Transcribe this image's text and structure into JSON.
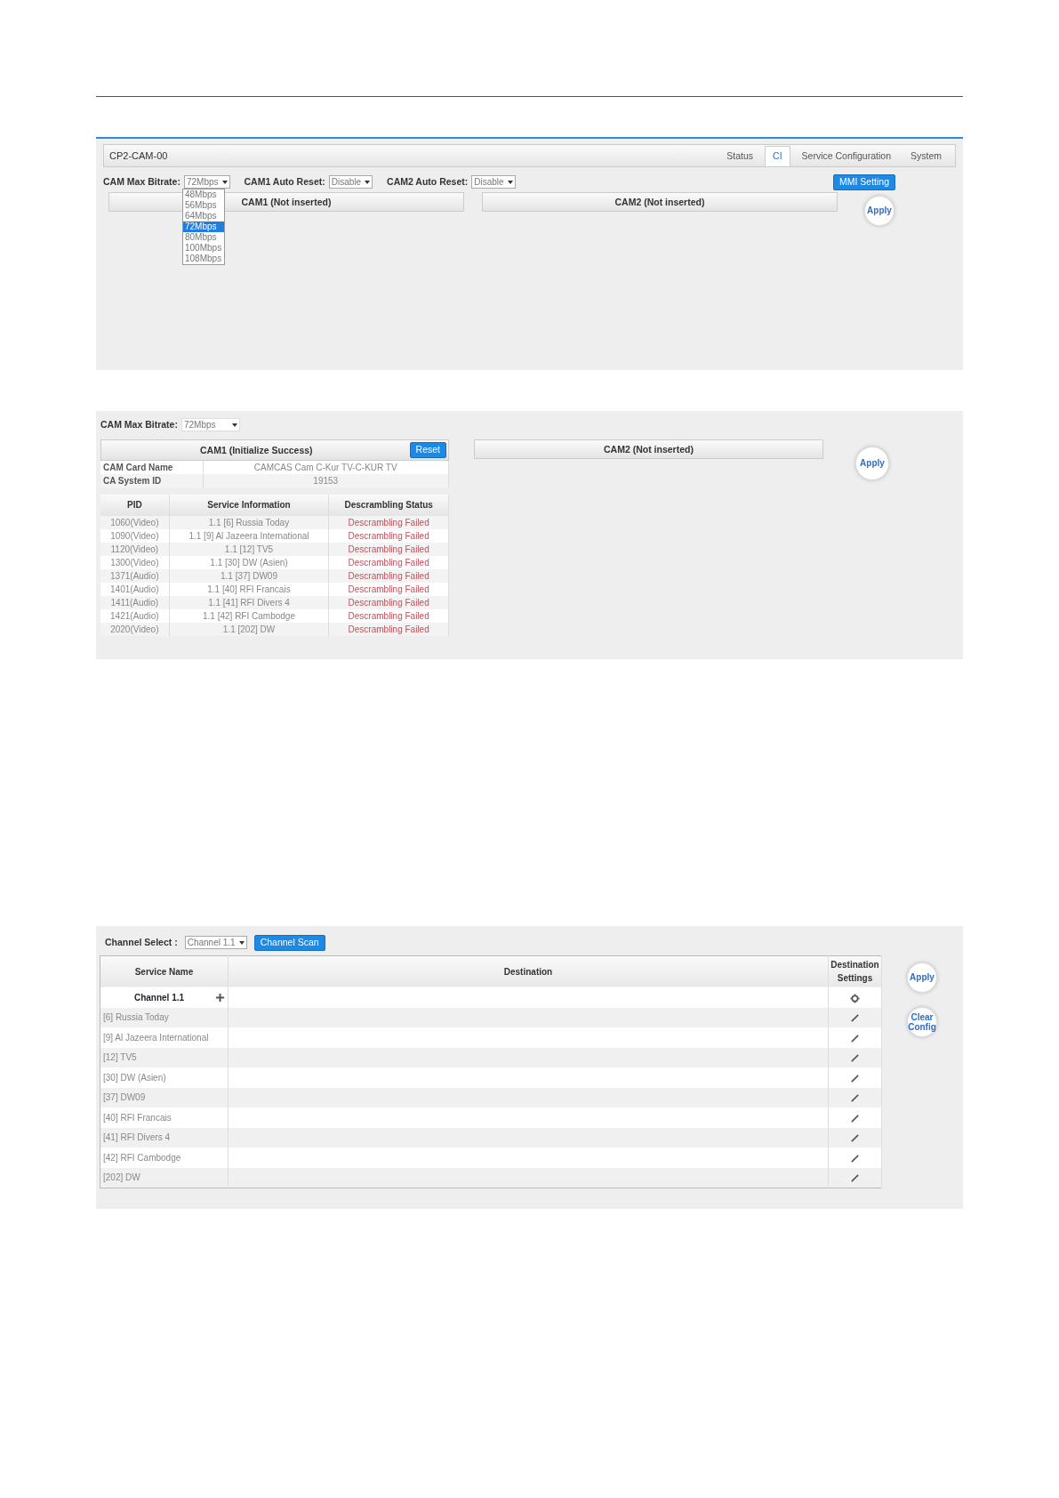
{
  "ci_panel": {
    "title": "CP2-CAM-00",
    "tabs": [
      {
        "label": "Status",
        "selected": false
      },
      {
        "label": "CI",
        "selected": true
      },
      {
        "label": "Service Configuration",
        "selected": false
      },
      {
        "label": "System",
        "selected": false
      }
    ],
    "bitrate": {
      "label": "CAM Max Bitrate:",
      "value": "72Mbps",
      "expanded": true,
      "options": [
        {
          "label": "48Mbps",
          "selected": false
        },
        {
          "label": "56Mbps",
          "selected": false
        },
        {
          "label": "64Mbps",
          "selected": false
        },
        {
          "label": "72Mbps",
          "selected": true
        },
        {
          "label": "80Mbps",
          "selected": false
        },
        {
          "label": "100Mbps",
          "selected": false
        },
        {
          "label": "108Mbps",
          "selected": false
        }
      ]
    },
    "auto_resets": [
      {
        "label": "CAM1 Auto Reset:",
        "value": "Disable"
      },
      {
        "label": "CAM2 Auto Reset:",
        "value": "Disable"
      }
    ],
    "mmi_button": "MMI Setting",
    "cams": [
      {
        "title": "CAM1 (Not inserted)"
      },
      {
        "title": "CAM2 (Not inserted)"
      }
    ],
    "apply": "Apply"
  },
  "cam_status_panel": {
    "bitrate": {
      "label": "CAM Max Bitrate:",
      "value": "72Mbps"
    },
    "cam1": {
      "title": "CAM1 (Initialize Success)",
      "reset": "Reset",
      "info": [
        {
          "label": "CAM Card Name",
          "value": "CAMCAS Cam C-Kur TV-C-KUR TV"
        },
        {
          "label": "CA System ID",
          "value": "19153"
        }
      ],
      "columns": [
        "PID",
        "Service Information",
        "Descrambling Status"
      ],
      "rows": [
        [
          "1060(Video)",
          "1.1 [6] Russia Today",
          "Descrambling Failed"
        ],
        [
          "1090(Video)",
          "1.1 [9] Al Jazeera International",
          "Descrambling Failed"
        ],
        [
          "1120(Video)",
          "1.1 [12] TV5",
          "Descrambling Failed"
        ],
        [
          "1300(Video)",
          "1.1 [30] DW (Asien)",
          "Descrambling Failed"
        ],
        [
          "1371(Audio)",
          "1.1 [37] DW09",
          "Descrambling Failed"
        ],
        [
          "1401(Audio)",
          "1.1 [40] RFI Francais",
          "Descrambling Failed"
        ],
        [
          "1411(Audio)",
          "1.1 [41] RFI Divers 4",
          "Descrambling Failed"
        ],
        [
          "1421(Audio)",
          "1.1 [42] RFI Cambodge",
          "Descrambling Failed"
        ],
        [
          "2020(Video)",
          "1.1 [202] DW",
          "Descrambling Failed"
        ]
      ]
    },
    "cam2": {
      "title": "CAM2 (Not inserted)"
    },
    "apply": "Apply"
  },
  "channel_panel": {
    "channel_select": {
      "label": "Channel Select :",
      "value": "Channel 1.1"
    },
    "scan_button": "Channel Scan",
    "columns": [
      "Service Name",
      "Destination",
      "Destination Settings"
    ],
    "rows": [
      {
        "kind": "channel",
        "name": "Channel 1.1"
      },
      {
        "kind": "service",
        "name": "[6] Russia Today"
      },
      {
        "kind": "service",
        "name": "[9] Al Jazeera International"
      },
      {
        "kind": "service",
        "name": "[12] TV5"
      },
      {
        "kind": "service",
        "name": "[30] DW (Asien)"
      },
      {
        "kind": "service",
        "name": "[37] DW09"
      },
      {
        "kind": "service",
        "name": "[40] RFI Francais"
      },
      {
        "kind": "service",
        "name": "[41] RFI Divers 4"
      },
      {
        "kind": "service",
        "name": "[42] RFI Cambodge"
      },
      {
        "kind": "service",
        "name": "[202] DW"
      }
    ],
    "apply": "Apply",
    "clear": "Clear Config"
  }
}
